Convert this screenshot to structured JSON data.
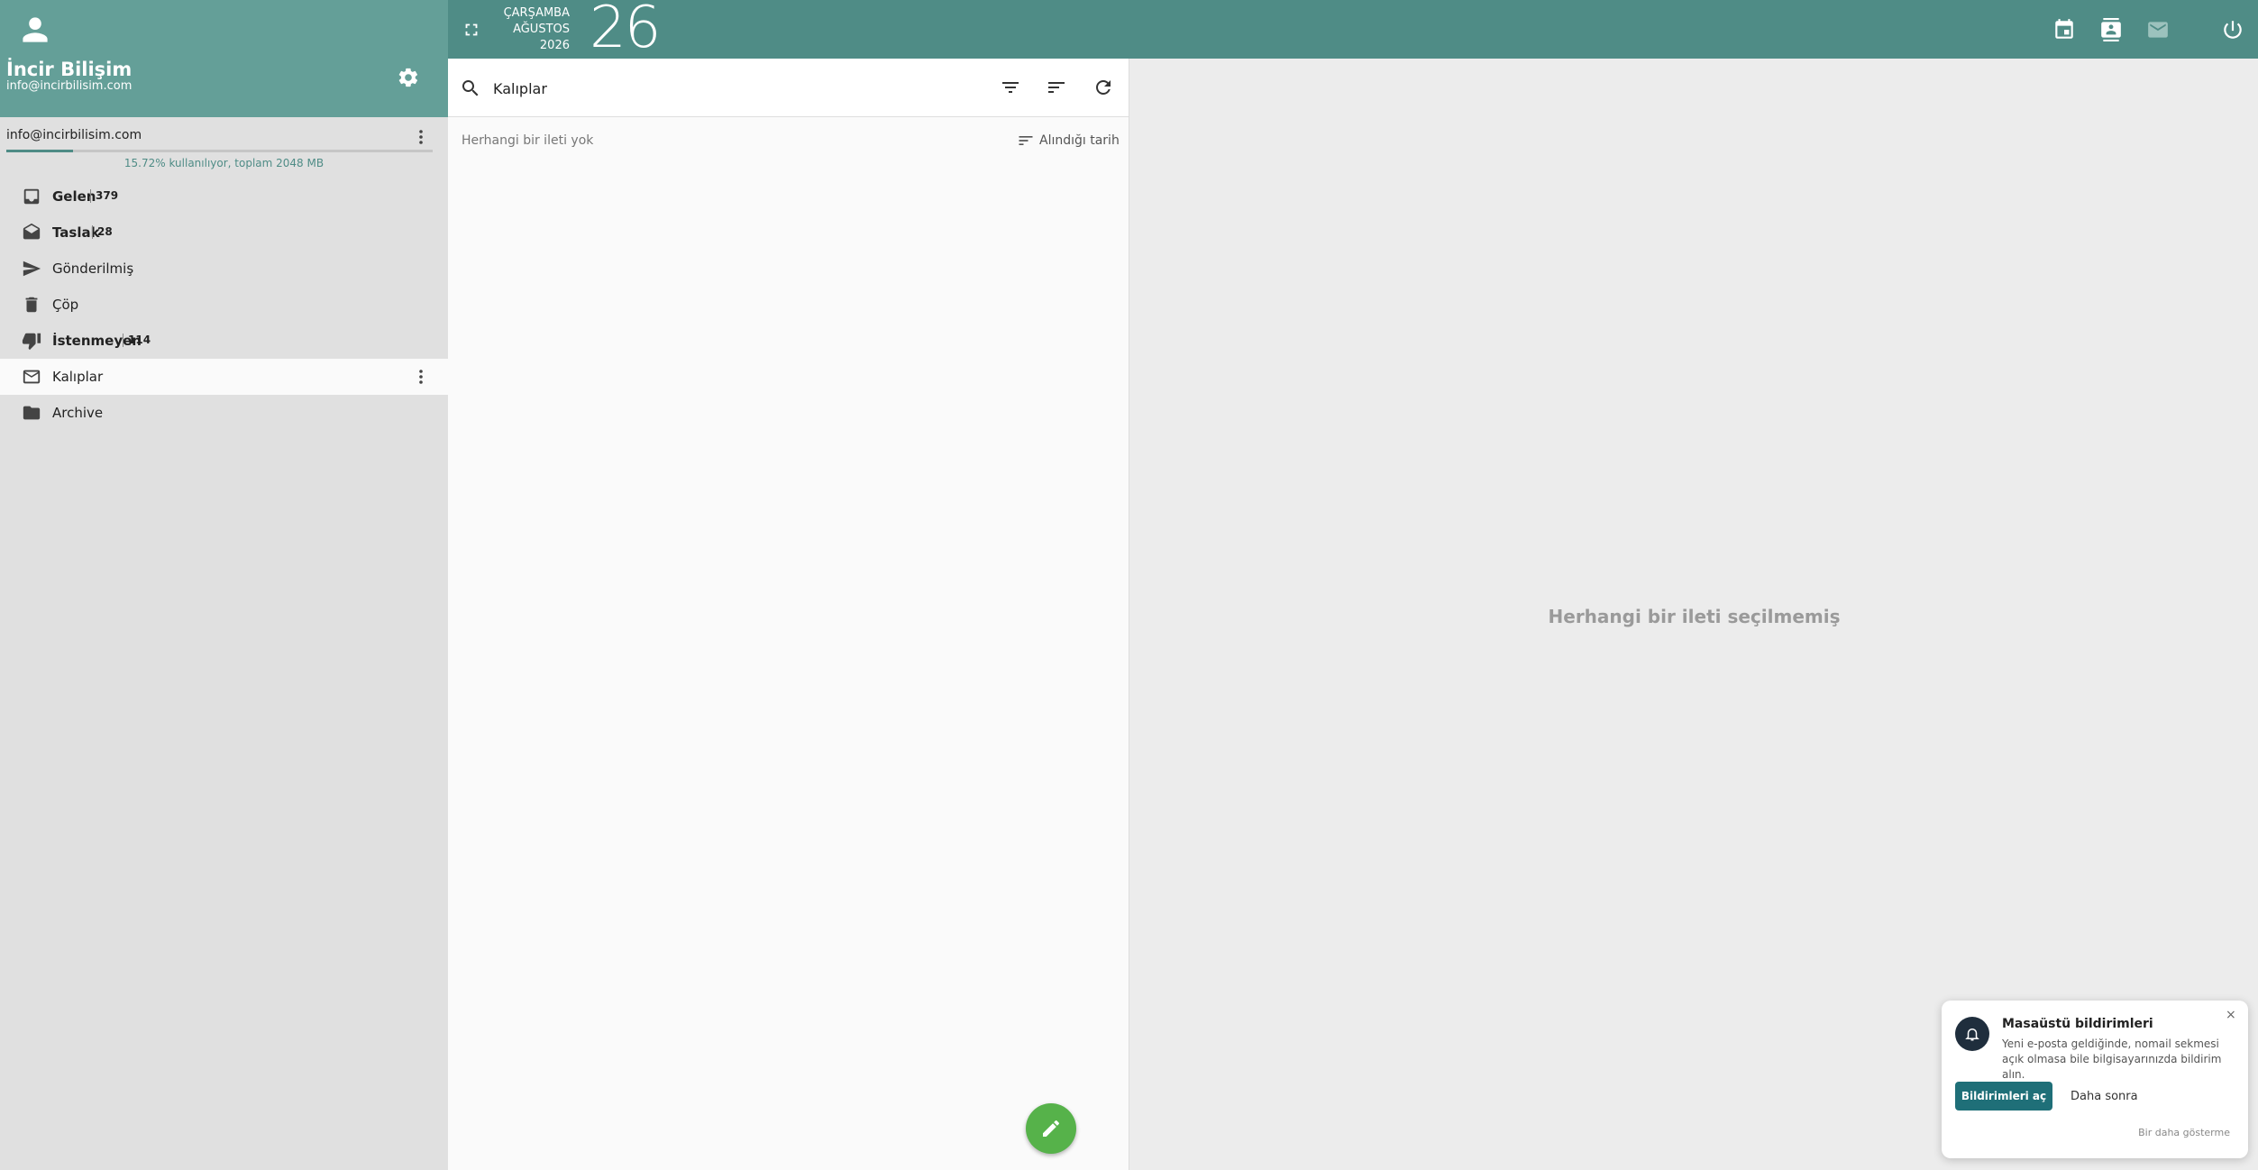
{
  "profile": {
    "name": "İncir Bilişim",
    "email": "info@incirbilisim.com"
  },
  "account": {
    "email": "info@incirbilisim.com",
    "quota_fraction": 0.1572,
    "quota_text": "15.72% kullanılıyor, toplam 2048 MB"
  },
  "folders": [
    {
      "label": "Gelen",
      "count": "379",
      "icon": "inbox-icon"
    },
    {
      "label": "Taslak",
      "count": "28",
      "icon": "drafts-icon"
    },
    {
      "label": "Gönderilmiş",
      "count": "",
      "icon": "send-icon"
    },
    {
      "label": "Çöp",
      "count": "",
      "icon": "trash-icon"
    },
    {
      "label": "İstenmeyen",
      "count": "114",
      "icon": "thumb-down-icon"
    },
    {
      "label": "Kalıplar",
      "count": "",
      "icon": "mail-outline-icon",
      "active": true
    },
    {
      "label": "Archive",
      "count": "",
      "icon": "folder-icon"
    }
  ],
  "topbar": {
    "weekday": "ÇARŞAMBA",
    "month": "AĞUSTOS",
    "year": "2026",
    "day": "26",
    "icons": [
      "calendar-icon",
      "contacts-icon",
      "mail-icon",
      "power-icon"
    ]
  },
  "list": {
    "search_value": "Kalıplar",
    "empty_text": "Herhangi bir ileti yok",
    "sort_label": "Alındığı tarih"
  },
  "reading": {
    "empty_text": "Herhangi bir ileti seçilmemiş"
  },
  "notification": {
    "title": "Masaüstü bildirimleri",
    "body": "Yeni e-posta geldiğinde, nomail sekmesi açık olmasa bile bilgisayarınızda bildirim alın.",
    "close": "×",
    "enable_label": "Bildirimleri aç",
    "later_label": "Daha sonra",
    "never_label": "Bir daha gösterme"
  },
  "colors": {
    "header_teal": "#4f8c86",
    "profile_teal": "#649f98",
    "compose_green": "#56b24a",
    "notif_button": "#1f6f78"
  }
}
